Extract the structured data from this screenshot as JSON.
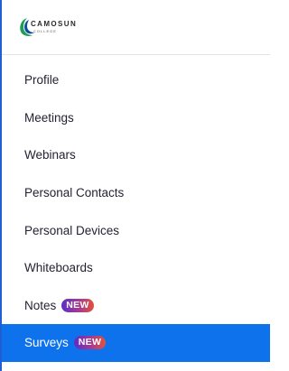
{
  "brand": {
    "name": "CAMOSUN",
    "subtitle": "COLLEGE",
    "colors": {
      "logo_green": "#1f9d55",
      "logo_blue": "#0b4ea2"
    }
  },
  "sidebar": {
    "items": [
      {
        "label": "Profile"
      },
      {
        "label": "Meetings"
      },
      {
        "label": "Webinars"
      },
      {
        "label": "Personal Contacts"
      },
      {
        "label": "Personal Devices"
      },
      {
        "label": "Whiteboards"
      },
      {
        "label": "Notes",
        "badge": "NEW"
      },
      {
        "label": "Surveys",
        "badge": "NEW",
        "active": true
      }
    ]
  },
  "colors": {
    "active_bg": "#0e72ed",
    "frame_border": "#1f5fd6",
    "text": "#232333"
  }
}
